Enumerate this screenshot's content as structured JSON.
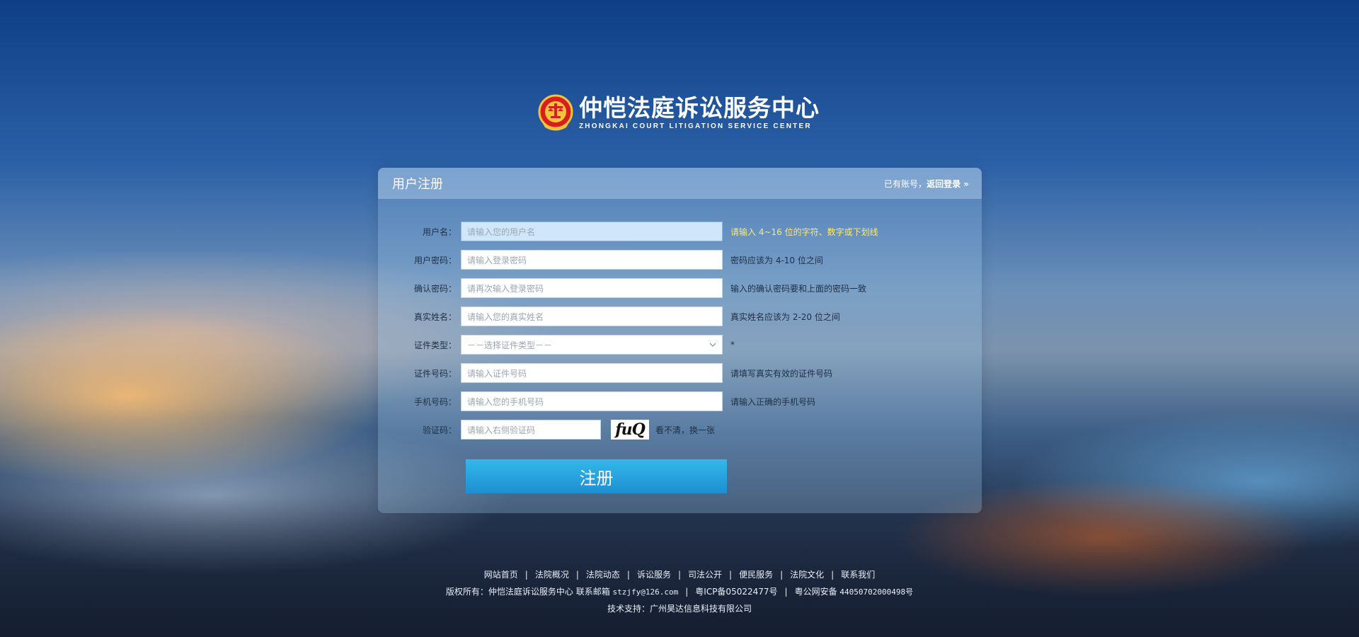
{
  "header": {
    "title_cn": "仲恺法庭诉讼服务中心",
    "title_en": "ZHONGKAI COURT LITIGATION SERVICE CENTER",
    "emblem_icon": "court-emblem-icon"
  },
  "panel": {
    "title": "用户注册",
    "login_prefix": "已有账号，",
    "login_link": "返回登录 »"
  },
  "form": {
    "fields": [
      {
        "label": "用户名：",
        "placeholder": "请输入您的用户名",
        "hint": "请输入 4~16 位的字符、数字或下划线"
      },
      {
        "label": "用户密码：",
        "placeholder": "请输入登录密码",
        "hint": "密码应该为 4-10 位之间"
      },
      {
        "label": "确认密码：",
        "placeholder": "请再次输入登录密码",
        "hint": "输入的确认密码要和上面的密码一致"
      },
      {
        "label": "真实姓名：",
        "placeholder": "请输入您的真实姓名",
        "hint": "真实姓名应该为 2-20 位之间"
      },
      {
        "label": "证件类型：",
        "selected": "－－选择证件类型－－",
        "hint": "*"
      },
      {
        "label": "证件号码：",
        "placeholder": "请输入证件号码",
        "hint": "请填写真实有效的证件号码"
      },
      {
        "label": "手机号码：",
        "placeholder": "请输入您的手机号码",
        "hint": "请输入正确的手机号码"
      },
      {
        "label": "验证码：",
        "placeholder": "请输入右侧验证码",
        "captcha": "fuQ",
        "refresh": "看不清，换一张"
      }
    ],
    "submit": "注册"
  },
  "footer": {
    "nav": [
      "网站首页",
      "法院概况",
      "法院动态",
      "诉讼服务",
      "司法公开",
      "便民服务",
      "法院文化",
      "联系我们"
    ],
    "copyright_prefix": "版权所有：仲恺法庭诉讼服务中心 联系邮箱 ",
    "email": "stzjfy@126.com",
    "icp": "粤ICP备05022477号",
    "police_prefix": "粤公网安备 ",
    "police_no": "44050702000498号",
    "tech": "技术支持：广州昊达信息科技有限公司"
  },
  "colors": {
    "accent": "#1d9bdc",
    "hint_warn": "#ffe86b"
  }
}
